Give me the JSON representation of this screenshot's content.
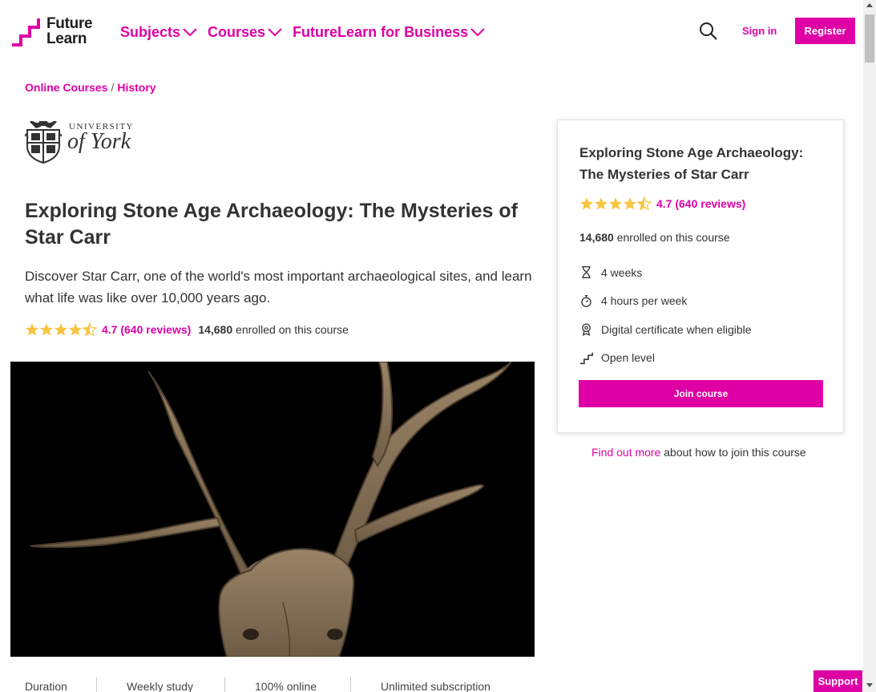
{
  "header": {
    "logo": {
      "line1": "Future",
      "line2": "Learn"
    },
    "nav": [
      {
        "label": "Subjects"
      },
      {
        "label": "Courses"
      },
      {
        "label": "FutureLearn for Business"
      }
    ],
    "signin_label": "Sign in",
    "register_label": "Register"
  },
  "breadcrumb": {
    "items": [
      "Online Courses",
      "History"
    ],
    "separator": "/"
  },
  "org": {
    "line1": "UNIVERSITY",
    "line2": "of York"
  },
  "course": {
    "title": "Exploring Stone Age Archaeology: The Mysteries of Star Carr",
    "description": "Discover Star Carr, one of the world's most important archaeological sites, and learn what life was like over 10,000 years ago.",
    "rating": {
      "value": 4.7,
      "label": "4.7",
      "reviews": "(640 reviews)"
    },
    "enrolled_count": "14,680",
    "enrolled_suffix": " enrolled on this course"
  },
  "facts": [
    {
      "label": "Duration"
    },
    {
      "label": "Weekly study"
    },
    {
      "label": "100% online"
    },
    {
      "label": "Unlimited subscription"
    }
  ],
  "card": {
    "title": "Exploring Stone Age Archaeology: The Mysteries of Star Carr",
    "rating_label": "4.7",
    "reviews": "(640 reviews)",
    "enrolled_count": "14,680",
    "enrolled_suffix": " enrolled on this course",
    "details": [
      {
        "icon": "hourglass-icon",
        "label": "4 weeks"
      },
      {
        "icon": "stopwatch-icon",
        "label": "4 hours per week"
      },
      {
        "icon": "certificate-icon",
        "label": "Digital certificate when eligible"
      },
      {
        "icon": "stairs-icon",
        "label": "Open level"
      }
    ],
    "join_label": "Join course"
  },
  "find_out": {
    "link": "Find out more",
    "suffix": " about how to join this course"
  },
  "support_label": "Support",
  "colors": {
    "accent": "#de00a5",
    "star": "#f7c543",
    "text": "#333333"
  }
}
